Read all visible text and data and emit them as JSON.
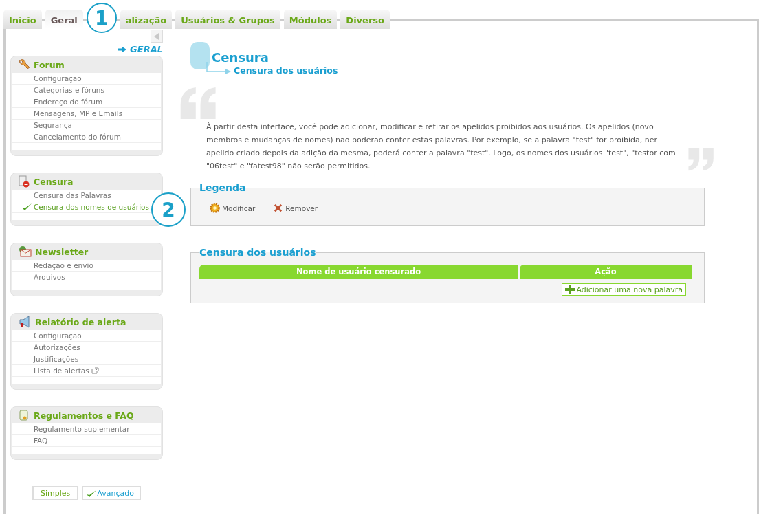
{
  "tabs": [
    {
      "label": "Inicio",
      "selected": false
    },
    {
      "label": "Geral",
      "selected": true
    },
    {
      "label": "alização",
      "selected": false
    },
    {
      "label": "Usuários & Grupos",
      "selected": false
    },
    {
      "label": "Módulos",
      "selected": false
    },
    {
      "label": "Diverso",
      "selected": false
    }
  ],
  "annotations": [
    {
      "label": "1"
    },
    {
      "label": "2"
    }
  ],
  "sidebar": {
    "breadcrumb": "GERAL",
    "sections": [
      {
        "title": "Forum",
        "items": [
          {
            "label": "Configuração",
            "selected": false,
            "external": false
          },
          {
            "label": "Categorias e fóruns",
            "selected": false,
            "external": false
          },
          {
            "label": "Endereço do fórum",
            "selected": false,
            "external": false
          },
          {
            "label": "Mensagens, MP e Emails",
            "selected": false,
            "external": false
          },
          {
            "label": "Segurança",
            "selected": false,
            "external": false
          },
          {
            "label": "Cancelamento do fórum",
            "selected": false,
            "external": false
          }
        ]
      },
      {
        "title": "Censura",
        "items": [
          {
            "label": "Censura das Palavras",
            "selected": false,
            "external": false
          },
          {
            "label": "Censura dos nomes de usuários",
            "selected": true,
            "external": false
          }
        ]
      },
      {
        "title": "Newsletter",
        "items": [
          {
            "label": "Redação e envio",
            "selected": false,
            "external": false
          },
          {
            "label": "Arquivos",
            "selected": false,
            "external": false
          }
        ]
      },
      {
        "title": "Relatório de alerta",
        "items": [
          {
            "label": "Configuração",
            "selected": false,
            "external": false
          },
          {
            "label": "Autorizações",
            "selected": false,
            "external": false
          },
          {
            "label": "Justificações",
            "selected": false,
            "external": false
          },
          {
            "label": "Lista de alertas",
            "selected": false,
            "external": true
          }
        ]
      },
      {
        "title": "Regulamentos e FAQ",
        "items": [
          {
            "label": "Regulamento suplementar",
            "selected": false,
            "external": false
          },
          {
            "label": "FAQ",
            "selected": false,
            "external": false
          }
        ]
      }
    ],
    "mode_buttons": [
      {
        "label": "Simples",
        "selected": false
      },
      {
        "label": "Avançado",
        "selected": true
      }
    ]
  },
  "page": {
    "title": "Censura",
    "subtitle": "Censura dos usuários",
    "description": [
      "À partir desta interface, você pode adicionar, modificar e retirar os apelidos proibidos aos usuários. Os apelidos (novo",
      "membros e mudanças de nomes) não poderão conter estas palavras. Por exemplo, se a palavra \"test\" for proibida, ner",
      "apelido criado depois da adição da mesma, poderá conter a palavra \"test\". Logo, os nomes dos usuários \"test\", \"testor com",
      "\"06test\" e \"fatest98\" não serão permitidos."
    ]
  },
  "legend": {
    "title": "Legenda",
    "items": [
      {
        "label": "Modificar"
      },
      {
        "label": "Remover"
      }
    ]
  },
  "table": {
    "title": "Censura dos usuários",
    "columns": [
      "Nome de usuário censurado",
      "Ação"
    ],
    "add_button": "Adicionar uma nova palavra"
  }
}
